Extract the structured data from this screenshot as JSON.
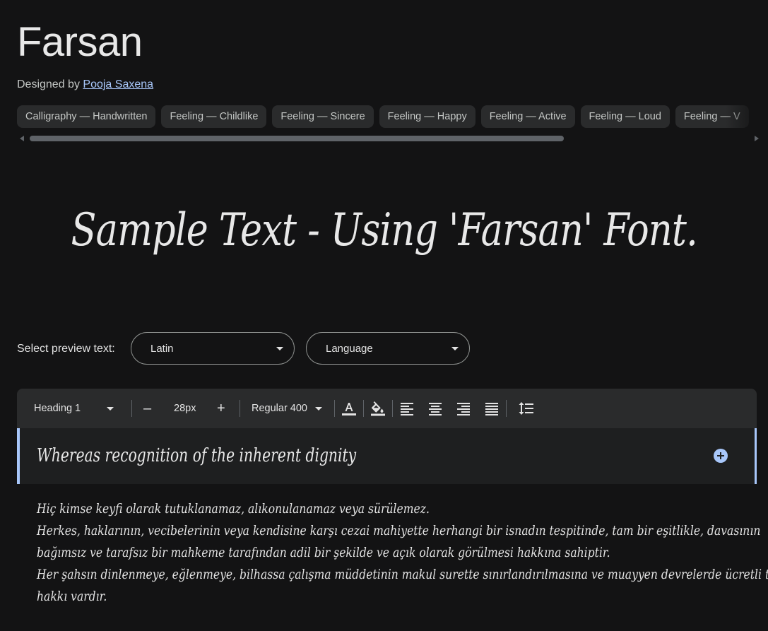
{
  "font": {
    "name": "Farsan",
    "designed_by_label": "Designed by",
    "designer": "Pooja Saxena"
  },
  "tags": [
    "Calligraphy — Handwritten",
    "Feeling — Childlike",
    "Feeling — Sincere",
    "Feeling — Happy",
    "Feeling — Active",
    "Feeling — Loud",
    "Feeling — V"
  ],
  "sample_text": "Sample Text - Using 'Farsan' Font.",
  "preview": {
    "label": "Select preview text:",
    "script_value": "Latin",
    "language_value": "Language"
  },
  "toolbar": {
    "style_value": "Heading 1",
    "decrease_label": "–",
    "size_value": "28px",
    "increase_label": "+",
    "weight_value": "Regular 400",
    "icons": [
      "text-color-icon",
      "highlight-icon",
      "align-left-icon",
      "align-center-icon",
      "align-right-icon",
      "align-justify-icon",
      "line-spacing-icon"
    ]
  },
  "editor": {
    "heading_text": "Whereas recognition of the inherent dignity"
  },
  "body_lines": [
    "Hiç kimse keyfi olarak tutuklanamaz, alıkonulanamaz veya sürülemez.",
    "Herkes, haklarının, vecibelerinin veya kendisine karşı cezai mahiyette herhangi bir isnadın tespitinde, tam bir eşitlikle, davasının",
    "bağımsız ve tarafsız bir mahkeme tarafından adil bir şekilde ve açık olarak görülmesi hakkına sahiptir.",
    "Her şahsın dinlenmeye, eğlenmeye, bilhassa çalışma müddetinin makul surette sınırlandırılmasına ve muayyen devrelerde ücretli tatillere",
    "hakkı vardır."
  ],
  "colors": {
    "background": "#131314",
    "accent": "#a8c7fa",
    "chip": "#2a2b2c"
  }
}
